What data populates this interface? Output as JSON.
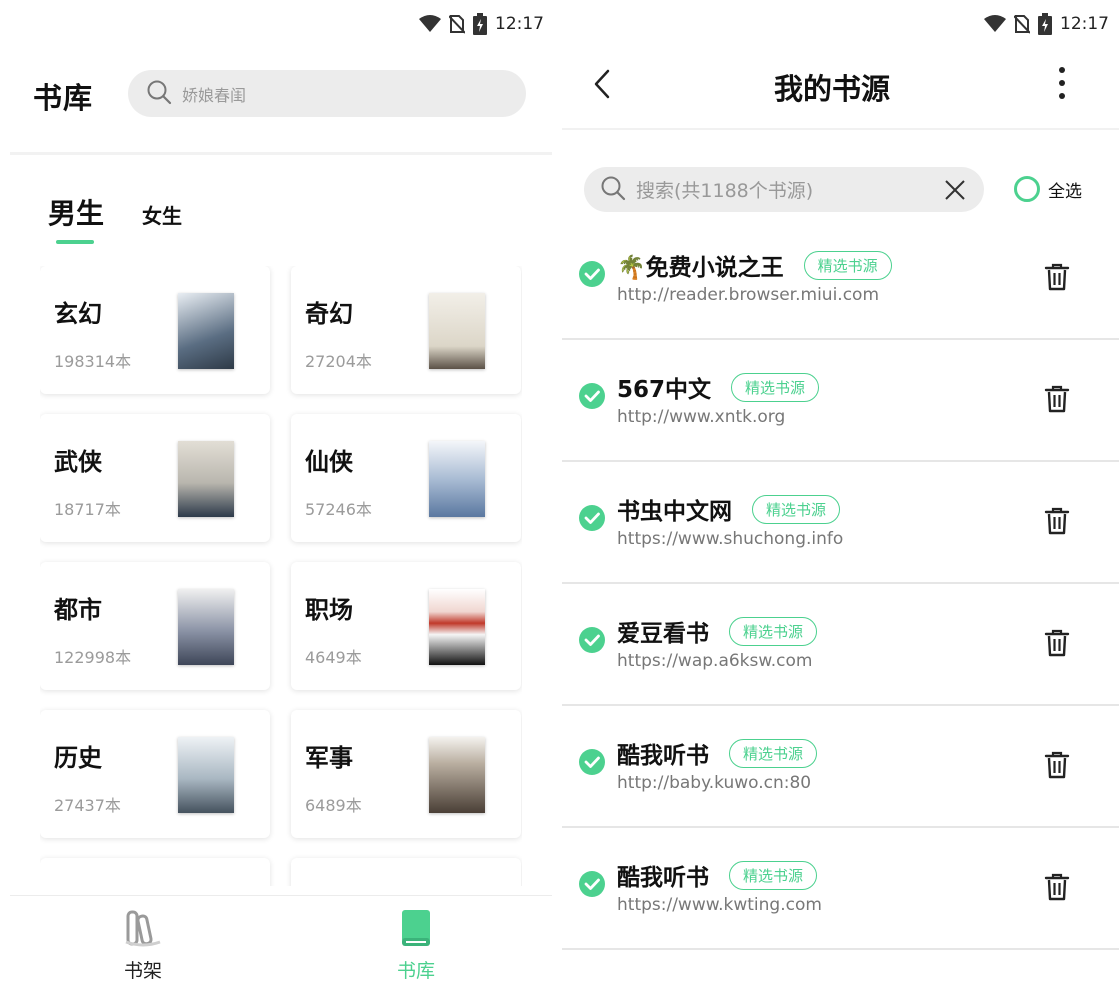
{
  "status_bar": {
    "time": "12:17"
  },
  "library": {
    "title": "书库",
    "search_placeholder": "娇娘春闺",
    "gender_tabs": [
      {
        "label": "男生",
        "active": true
      },
      {
        "label": "女生",
        "active": false
      }
    ],
    "categories": [
      {
        "name": "玄幻",
        "count": "198314本",
        "cover_front": "#5a6d82",
        "cover_back": "#8a98a8"
      },
      {
        "name": "奇幻",
        "count": "27204本",
        "cover_front": "#e8e4da",
        "cover_back": "#c9a24a"
      },
      {
        "name": "武侠",
        "count": "18717本",
        "cover_front": "#b9b6ae",
        "cover_back": "#e6dfcf"
      },
      {
        "name": "仙侠",
        "count": "57246本",
        "cover_front": "#7c97b8",
        "cover_back": "#d9d2a8"
      },
      {
        "name": "都市",
        "count": "122998本",
        "cover_front": "#8b93a6",
        "cover_back": "#4a4a4a"
      },
      {
        "name": "职场",
        "count": "4649本",
        "cover_front": "#c0392b",
        "cover_back": "#9ec9a3"
      },
      {
        "name": "历史",
        "count": "27437本",
        "cover_front": "#a9b7c2",
        "cover_back": "#b58a63"
      },
      {
        "name": "军事",
        "count": "6489本",
        "cover_front": "#6e6258",
        "cover_back": "#8c6a55"
      }
    ],
    "nav": [
      {
        "label": "书架",
        "active": false
      },
      {
        "label": "书库",
        "active": true
      }
    ]
  },
  "sources": {
    "title": "我的书源",
    "search_placeholder": "搜索(共1188个书源)",
    "select_all_label": "全选",
    "badge_label": "精选书源",
    "items": [
      {
        "name": "🌴免费小说之王",
        "url": "http://reader.browser.miui.com"
      },
      {
        "name": "567中文",
        "url": "http://www.xntk.org"
      },
      {
        "name": "书虫中文网",
        "url": "https://www.shuchong.info"
      },
      {
        "name": "爱豆看书",
        "url": "https://wap.a6ksw.com"
      },
      {
        "name": "酷我听书",
        "url": "http://baby.kuwo.cn:80"
      },
      {
        "name": "酷我听书",
        "url": "https://www.kwting.com"
      }
    ]
  },
  "colors": {
    "accent": "#4cd18f",
    "nav_inactive": "#9a9a9a"
  }
}
